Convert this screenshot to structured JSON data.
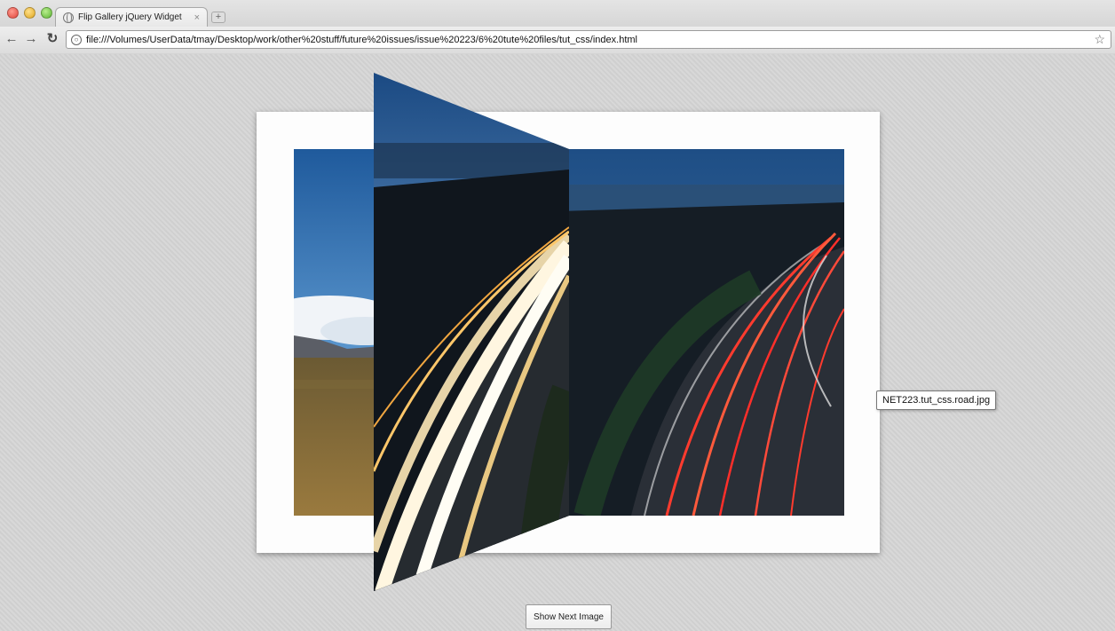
{
  "window": {
    "tab_title": "Flip Gallery jQuery Widget",
    "tab_close": "×",
    "new_tab": "+",
    "url": "file:///Volumes/UserData/tmay/Desktop/work/other%20stuff/future%20issues/issue%20223/6%20tute%20files/tut_css/index.html",
    "nav": {
      "back": "←",
      "forward": "→",
      "reload": "↻",
      "bookmark": "☆"
    }
  },
  "gallery": {
    "tooltip": "NET223.tut_css.road.jpg",
    "next_button_label": "Show Next Image"
  },
  "colors": {
    "page_background": "#d6d6d6",
    "frame": "#fdfdfd",
    "sky_blue": "#3a6fa6",
    "light_trail_white": "#fff6e0",
    "light_trail_red": "#ff3b2e"
  }
}
